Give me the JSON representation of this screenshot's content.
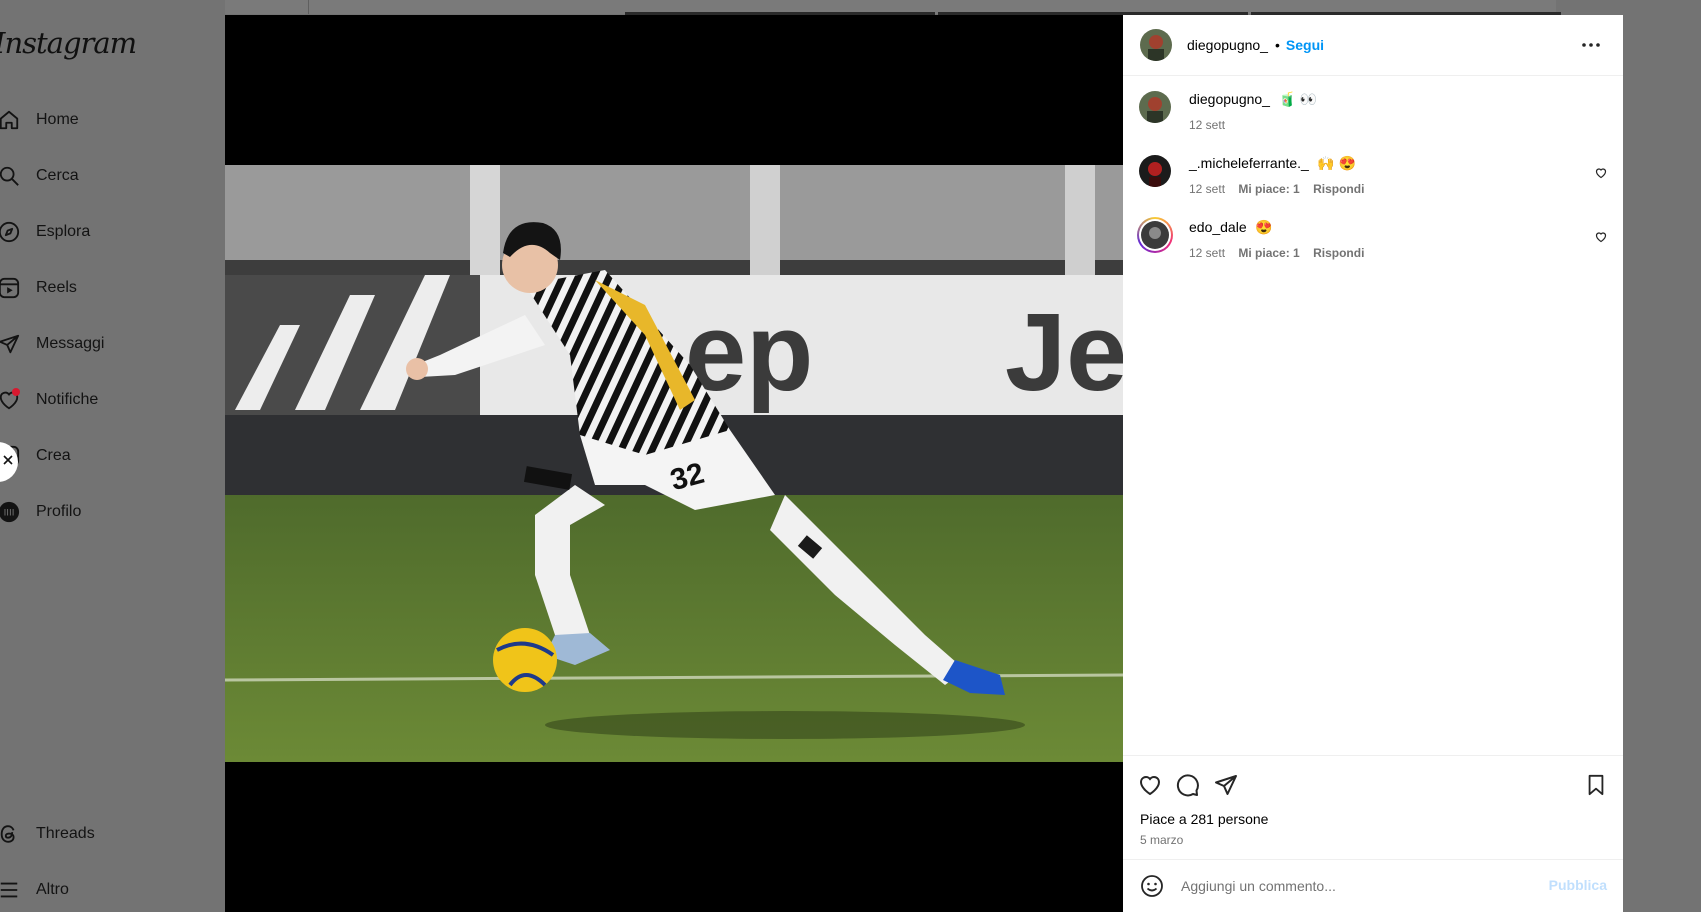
{
  "app": {
    "logo_text": "Instagram",
    "nav": [
      {
        "label": "Home",
        "icon": "home-icon"
      },
      {
        "label": "Cerca",
        "icon": "search-icon"
      },
      {
        "label": "Esplora",
        "icon": "compass-icon"
      },
      {
        "label": "Reels",
        "icon": "reels-icon"
      },
      {
        "label": "Messaggi",
        "icon": "send-icon"
      },
      {
        "label": "Notifiche",
        "icon": "heart-icon"
      },
      {
        "label": "Crea",
        "icon": "create-icon"
      },
      {
        "label": "Profilo",
        "icon": "profile-icon"
      }
    ],
    "bottom_nav": [
      {
        "label": "Threads",
        "icon": "threads-icon"
      },
      {
        "label": "Altro",
        "icon": "menu-icon"
      }
    ]
  },
  "post": {
    "author": "diegopugno_",
    "separator": "•",
    "follow_label": "Segui",
    "caption_text": "🧃 👀",
    "caption_time": "12 sett",
    "comments": [
      {
        "user": "_.micheleferrante._",
        "text": "🙌 😍",
        "time": "12 sett",
        "likes": "Mi piace: 1",
        "reply": "Rispondi"
      },
      {
        "user": "edo_dale",
        "text": "😍",
        "time": "12 sett",
        "likes": "Mi piace: 1",
        "reply": "Rispondi"
      }
    ],
    "likes_text": "Piace a 281 persone",
    "date_text": "5 marzo",
    "comment_placeholder": "Aggiungi un commento...",
    "publish_label": "Pubblica"
  },
  "colors": {
    "overlay": "#737373",
    "link_blue": "#0095f6",
    "publish_disabled": "#c0dffd",
    "notification_dot": "#d7192f"
  }
}
